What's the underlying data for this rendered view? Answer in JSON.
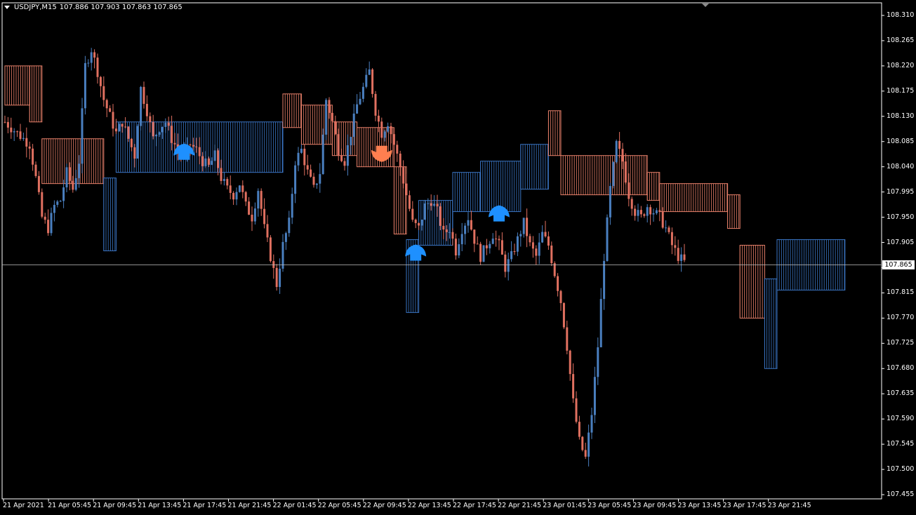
{
  "header": {
    "symbol": "USDJPY,M15",
    "ohlc": "107.886 107.903 107.863 107.865"
  },
  "colors": {
    "background": "#000000",
    "bull": "#4a7fbf",
    "bear": "#e07060",
    "cloud_bull": "#3a75c4",
    "cloud_bear": "#e8806a",
    "arrow_up": "#1e90ff",
    "arrow_down": "#ff7f50",
    "grid_frame": "#ffffff",
    "price_line": "#c0c0c0"
  },
  "chart_data": {
    "type": "candlestick",
    "instrument": "USDJPY",
    "timeframe": "M15",
    "ylim": [
      107.455,
      108.31
    ],
    "y_ticks": [
      "108.310",
      "108.265",
      "108.220",
      "108.175",
      "108.130",
      "108.085",
      "108.040",
      "107.995",
      "107.950",
      "107.905",
      "107.860",
      "107.815",
      "107.770",
      "107.725",
      "107.680",
      "107.635",
      "107.590",
      "107.545",
      "107.500",
      "107.455"
    ],
    "x_ticks": [
      "21 Apr 2021",
      "21 Apr 05:45",
      "21 Apr 09:45",
      "21 Apr 13:45",
      "21 Apr 17:45",
      "21 Apr 21:45",
      "22 Apr 01:45",
      "22 Apr 05:45",
      "22 Apr 09:45",
      "22 Apr 13:45",
      "22 Apr 17:45",
      "22 Apr 21:45",
      "23 Apr 01:45",
      "23 Apr 05:45",
      "23 Apr 09:45",
      "23 Apr 13:45",
      "23 Apr 17:45",
      "23 Apr 21:45"
    ],
    "current_price": "107.865",
    "close_path": [
      [
        0,
        108.12
      ],
      [
        4,
        108.1
      ],
      [
        8,
        108.08
      ],
      [
        10,
        108.02
      ],
      [
        12,
        107.95
      ],
      [
        14,
        107.93
      ],
      [
        16,
        107.97
      ],
      [
        18,
        107.98
      ],
      [
        20,
        108.03
      ],
      [
        22,
        108.0
      ],
      [
        24,
        108.05
      ],
      [
        26,
        108.22
      ],
      [
        28,
        108.25
      ],
      [
        30,
        108.21
      ],
      [
        32,
        108.16
      ],
      [
        34,
        108.13
      ],
      [
        36,
        108.1
      ],
      [
        38,
        108.12
      ],
      [
        40,
        108.09
      ],
      [
        42,
        108.06
      ],
      [
        44,
        108.18
      ],
      [
        46,
        108.14
      ],
      [
        48,
        108.09
      ],
      [
        50,
        108.11
      ],
      [
        52,
        108.12
      ],
      [
        54,
        108.09
      ],
      [
        56,
        108.07
      ],
      [
        58,
        108.06
      ],
      [
        60,
        108.08
      ],
      [
        62,
        108.07
      ],
      [
        64,
        108.05
      ],
      [
        66,
        108.04
      ],
      [
        68,
        108.06
      ],
      [
        70,
        108.02
      ],
      [
        72,
        108.0
      ],
      [
        74,
        107.99
      ],
      [
        76,
        108.01
      ],
      [
        78,
        107.97
      ],
      [
        80,
        107.95
      ],
      [
        82,
        108.0
      ],
      [
        84,
        107.93
      ],
      [
        86,
        107.88
      ],
      [
        88,
        107.83
      ],
      [
        90,
        107.9
      ],
      [
        92,
        107.94
      ],
      [
        94,
        108.05
      ],
      [
        96,
        108.07
      ],
      [
        98,
        108.03
      ],
      [
        100,
        108.0
      ],
      [
        102,
        108.03
      ],
      [
        104,
        108.16
      ],
      [
        106,
        108.12
      ],
      [
        108,
        108.07
      ],
      [
        110,
        108.05
      ],
      [
        112,
        108.1
      ],
      [
        114,
        108.15
      ],
      [
        116,
        108.18
      ],
      [
        118,
        108.21
      ],
      [
        120,
        108.14
      ],
      [
        122,
        108.1
      ],
      [
        124,
        108.12
      ],
      [
        126,
        108.08
      ],
      [
        128,
        108.04
      ],
      [
        130,
        107.99
      ],
      [
        132,
        107.94
      ],
      [
        134,
        107.93
      ],
      [
        136,
        107.97
      ],
      [
        138,
        107.98
      ],
      [
        140,
        107.96
      ],
      [
        142,
        107.92
      ],
      [
        144,
        107.93
      ],
      [
        146,
        107.89
      ],
      [
        148,
        107.93
      ],
      [
        150,
        107.95
      ],
      [
        152,
        107.91
      ],
      [
        154,
        107.88
      ],
      [
        156,
        107.9
      ],
      [
        158,
        107.92
      ],
      [
        160,
        107.9
      ],
      [
        162,
        107.86
      ],
      [
        164,
        107.88
      ],
      [
        166,
        107.91
      ],
      [
        168,
        107.94
      ],
      [
        170,
        107.9
      ],
      [
        172,
        107.88
      ],
      [
        174,
        107.92
      ],
      [
        176,
        107.9
      ],
      [
        178,
        107.85
      ],
      [
        180,
        107.8
      ],
      [
        182,
        107.72
      ],
      [
        184,
        107.62
      ],
      [
        186,
        107.55
      ],
      [
        188,
        107.52
      ],
      [
        190,
        107.6
      ],
      [
        192,
        107.72
      ],
      [
        194,
        107.88
      ],
      [
        196,
        108.0
      ],
      [
        198,
        108.08
      ],
      [
        200,
        108.05
      ],
      [
        202,
        107.99
      ],
      [
        204,
        107.96
      ],
      [
        206,
        107.95
      ],
      [
        208,
        107.97
      ],
      [
        210,
        107.96
      ],
      [
        212,
        107.95
      ],
      [
        214,
        107.93
      ],
      [
        216,
        107.9
      ],
      [
        218,
        107.88
      ],
      [
        220,
        107.87
      ]
    ],
    "arrows": [
      {
        "type": "up",
        "index": 58,
        "price": 108.07
      },
      {
        "type": "down",
        "index": 122,
        "price": 108.06
      },
      {
        "type": "up",
        "index": 133,
        "price": 107.89
      },
      {
        "type": "up",
        "index": 160,
        "price": 107.96
      }
    ],
    "cloud_segments": [
      {
        "color": "bear",
        "from": 0,
        "to": 8,
        "top": 108.22,
        "bottom": 108.15
      },
      {
        "color": "bear",
        "from": 8,
        "to": 12,
        "top": 108.22,
        "bottom": 108.12
      },
      {
        "color": "bear",
        "from": 12,
        "to": 32,
        "top": 108.09,
        "bottom": 108.01
      },
      {
        "color": "bull",
        "from": 32,
        "to": 36,
        "top": 108.02,
        "bottom": 107.89
      },
      {
        "color": "bull",
        "from": 36,
        "to": 90,
        "top": 108.12,
        "bottom": 108.03
      },
      {
        "color": "bear",
        "from": 90,
        "to": 96,
        "top": 108.17,
        "bottom": 108.11
      },
      {
        "color": "bear",
        "from": 96,
        "to": 106,
        "top": 108.15,
        "bottom": 108.08
      },
      {
        "color": "bear",
        "from": 106,
        "to": 114,
        "top": 108.12,
        "bottom": 108.06
      },
      {
        "color": "bear",
        "from": 114,
        "to": 126,
        "top": 108.11,
        "bottom": 108.04
      },
      {
        "color": "bear",
        "from": 126,
        "to": 130,
        "top": 108.04,
        "bottom": 107.92
      },
      {
        "color": "bull",
        "from": 130,
        "to": 134,
        "top": 107.91,
        "bottom": 107.78
      },
      {
        "color": "bull",
        "from": 134,
        "to": 145,
        "top": 107.98,
        "bottom": 107.9
      },
      {
        "color": "bull",
        "from": 145,
        "to": 154,
        "top": 108.03,
        "bottom": 107.96
      },
      {
        "color": "bull",
        "from": 154,
        "to": 167,
        "top": 108.05,
        "bottom": 107.96
      },
      {
        "color": "bull",
        "from": 167,
        "to": 176,
        "top": 108.08,
        "bottom": 108.0
      },
      {
        "color": "bear",
        "from": 176,
        "to": 180,
        "top": 108.14,
        "bottom": 108.06
      },
      {
        "color": "bear",
        "from": 180,
        "to": 208,
        "top": 108.06,
        "bottom": 107.99
      },
      {
        "color": "bear",
        "from": 208,
        "to": 212,
        "top": 108.03,
        "bottom": 107.98
      },
      {
        "color": "bear",
        "from": 212,
        "to": 234,
        "top": 108.01,
        "bottom": 107.96
      },
      {
        "color": "bear",
        "from": 234,
        "to": 238,
        "top": 107.99,
        "bottom": 107.93
      },
      {
        "color": "bear",
        "from": 238,
        "to": 246,
        "top": 107.9,
        "bottom": 107.77
      },
      {
        "color": "bull",
        "from": 246,
        "to": 250,
        "top": 107.84,
        "bottom": 107.68
      },
      {
        "color": "bull",
        "from": 250,
        "to": 272,
        "top": 107.91,
        "bottom": 107.82
      }
    ]
  }
}
